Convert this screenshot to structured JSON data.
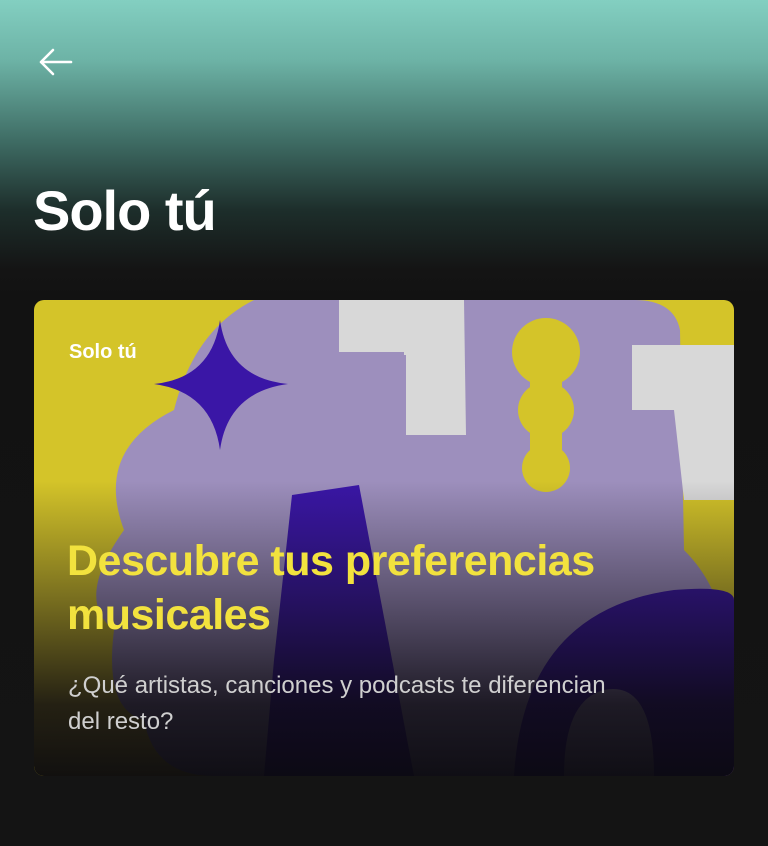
{
  "header": {
    "back_icon": "arrow-left-icon",
    "title": "Solo tú"
  },
  "card": {
    "tag": "Solo tú",
    "headline": "Descubre tus preferencias musicales",
    "subtitle": "¿Qué artistas, canciones y podcasts te diferencian del resto?"
  },
  "colors": {
    "header_teal": "#83cfc1",
    "background": "#121212",
    "card_yellow": "#d4c429",
    "card_lavender": "#9d8fbd",
    "card_indigo": "#3a16a6",
    "card_gray": "#d8d8d8",
    "headline_yellow": "#f2e23e"
  }
}
